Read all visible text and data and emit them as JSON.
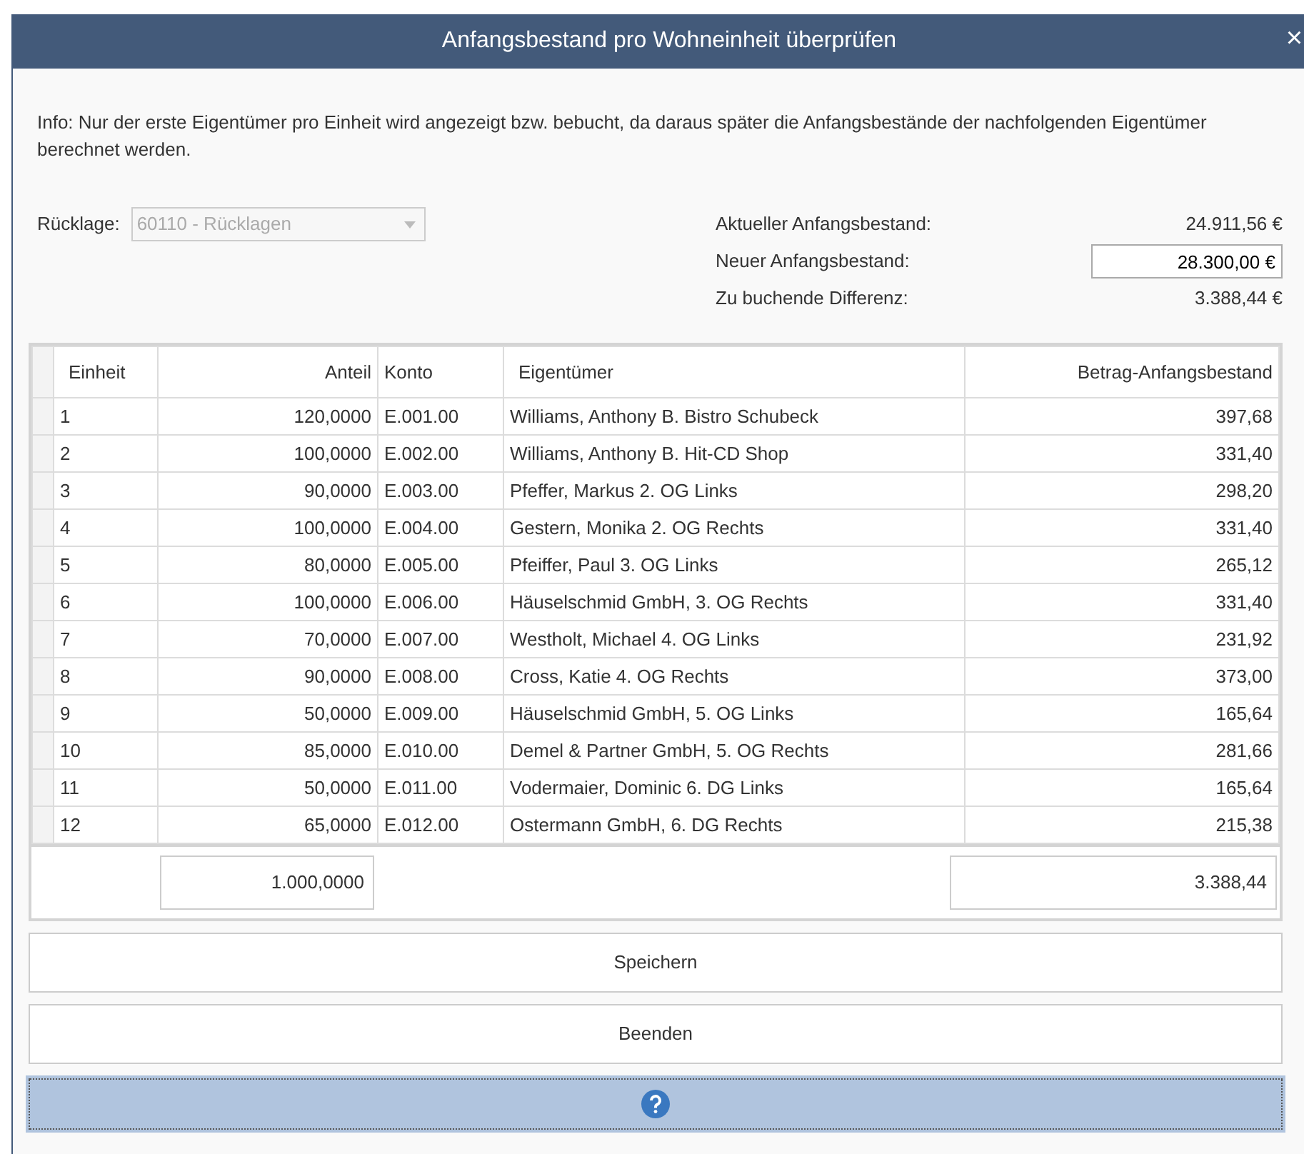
{
  "window": {
    "title": "Anfangsbestand pro Wohneinheit überprüfen",
    "close": "×"
  },
  "info": "Info: Nur der erste Eigentümer pro Einheit wird angezeigt bzw. bebucht, da daraus später die Anfangsbestände der nachfolgenden Eigentümer berechnet werden.",
  "reserve": {
    "label": "Rücklage:",
    "value": "60110 - Rücklagen",
    "disabled": true
  },
  "balances": [
    {
      "kind": "text",
      "label": "Aktueller Anfangsbestand:",
      "value": "24.911,56 €"
    },
    {
      "kind": "input",
      "label": "Neuer Anfangsbestand:",
      "value": "28.300,00 €"
    },
    {
      "kind": "text",
      "label": "Zu buchende Differenz:",
      "value": "3.388,44 €"
    }
  ],
  "table": {
    "columns": [
      "Einheit",
      "Anteil",
      "Konto",
      "Eigentümer",
      "Betrag-Anfangsbestand"
    ],
    "rows": [
      [
        "1",
        "120,0000",
        "E.001.00",
        "Williams, Anthony B. Bistro Schubeck",
        "397,68"
      ],
      [
        "2",
        "100,0000",
        "E.002.00",
        "Williams, Anthony B. Hit-CD Shop",
        "331,40"
      ],
      [
        "3",
        "90,0000",
        "E.003.00",
        "Pfeffer, Markus 2. OG Links",
        "298,20"
      ],
      [
        "4",
        "100,0000",
        "E.004.00",
        "Gestern, Monika 2. OG Rechts",
        "331,40"
      ],
      [
        "5",
        "80,0000",
        "E.005.00",
        "Pfeiffer, Paul 3. OG Links",
        "265,12"
      ],
      [
        "6",
        "100,0000",
        "E.006.00",
        "Häuselschmid GmbH,  3. OG Rechts",
        "331,40"
      ],
      [
        "7",
        "70,0000",
        "E.007.00",
        "Westholt, Michael 4. OG Links",
        "231,92"
      ],
      [
        "8",
        "90,0000",
        "E.008.00",
        "Cross, Katie 4. OG Rechts",
        "373,00"
      ],
      [
        "9",
        "50,0000",
        "E.009.00",
        "Häuselschmid GmbH,  5. OG Links",
        "165,64"
      ],
      [
        "10",
        "85,0000",
        "E.010.00",
        "Demel & Partner GmbH,  5. OG Rechts",
        "281,66"
      ],
      [
        "11",
        "50,0000",
        "E.011.00",
        "Vodermaier, Dominic 6. DG Links",
        "165,64"
      ],
      [
        "12",
        "65,0000",
        "E.012.00",
        "Ostermann GmbH,  6. DG Rechts",
        "215,38"
      ]
    ],
    "totals": {
      "share": "1.000,0000",
      "amount": "3.388,44"
    }
  },
  "buttons": [
    {
      "kind": "text",
      "label": "Speichern"
    },
    {
      "kind": "text",
      "label": "Beenden"
    },
    {
      "kind": "help",
      "focused": true
    }
  ]
}
